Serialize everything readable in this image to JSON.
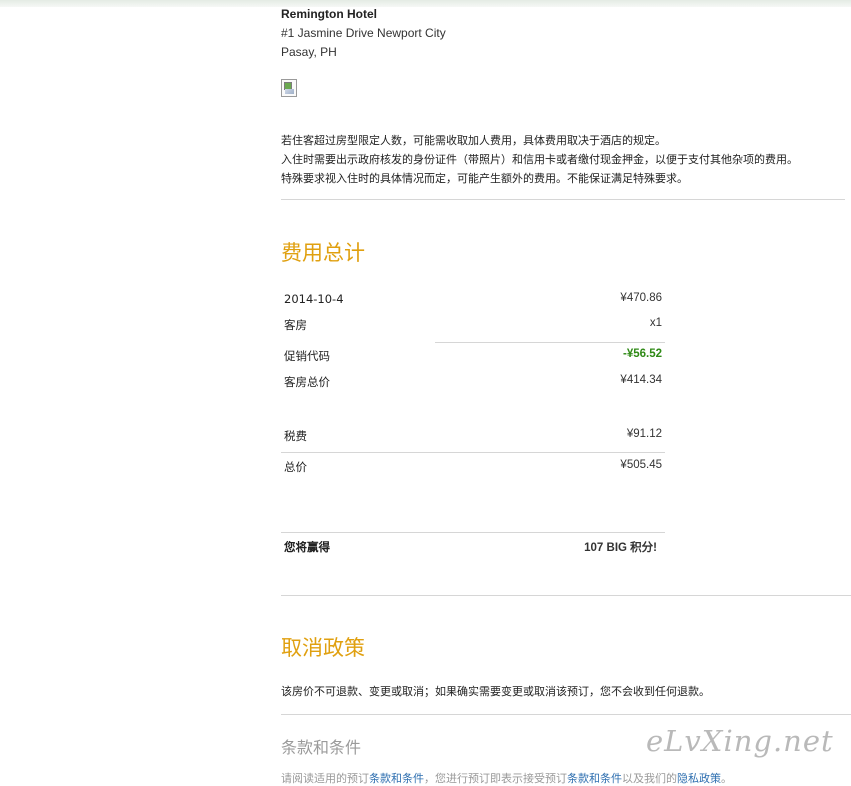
{
  "hotel": {
    "name": "Remington Hotel",
    "address_line1": "#1 Jasmine Drive Newport City",
    "address_line2": "Pasay, PH"
  },
  "notes": [
    "若住客超过房型限定人数，可能需收取加人费用，具体费用取决于酒店的规定。",
    "入住时需要出示政府核发的身份证件（带照片）和信用卡或者缴付现金押金，以便于支付其他杂项的费用。",
    "特殊要求视入住时的具体情况而定，可能产生额外的费用。不能保证满足特殊要求。"
  ],
  "fees": {
    "title": "费用总计",
    "date": "2014-10-4",
    "nightly_price": "¥470.86",
    "room_label": "客房",
    "room_qty": "x1",
    "promo_label": "促销代码",
    "promo_value": "-¥56.52",
    "room_total_label": "客房总价",
    "room_total_value": "¥414.34",
    "tax_label": "税费",
    "tax_value": "¥91.12",
    "total_label": "总价",
    "total_value": "¥505.45",
    "earn_label": "您将赢得",
    "earn_value": "107 BIG 积分!"
  },
  "cancel": {
    "title": "取消政策",
    "text": "该房价不可退款、变更或取消；如果确实需要变更或取消该预订，您不会收到任何退款。"
  },
  "terms": {
    "title": "条款和条件",
    "line_start": "请阅读适用的预订",
    "link1": "条款和条件",
    "line_mid": "，您进行预订即表示接受预订",
    "link2": "条款和条件",
    "line_mid2": "以及我们的",
    "link3": "隐私政策",
    "line_end": "。"
  },
  "watermark": "eLvXing.net",
  "colors": {
    "section_title": "#e0a010",
    "promo_green": "#2f8a16",
    "link": "#2e6fb0"
  }
}
